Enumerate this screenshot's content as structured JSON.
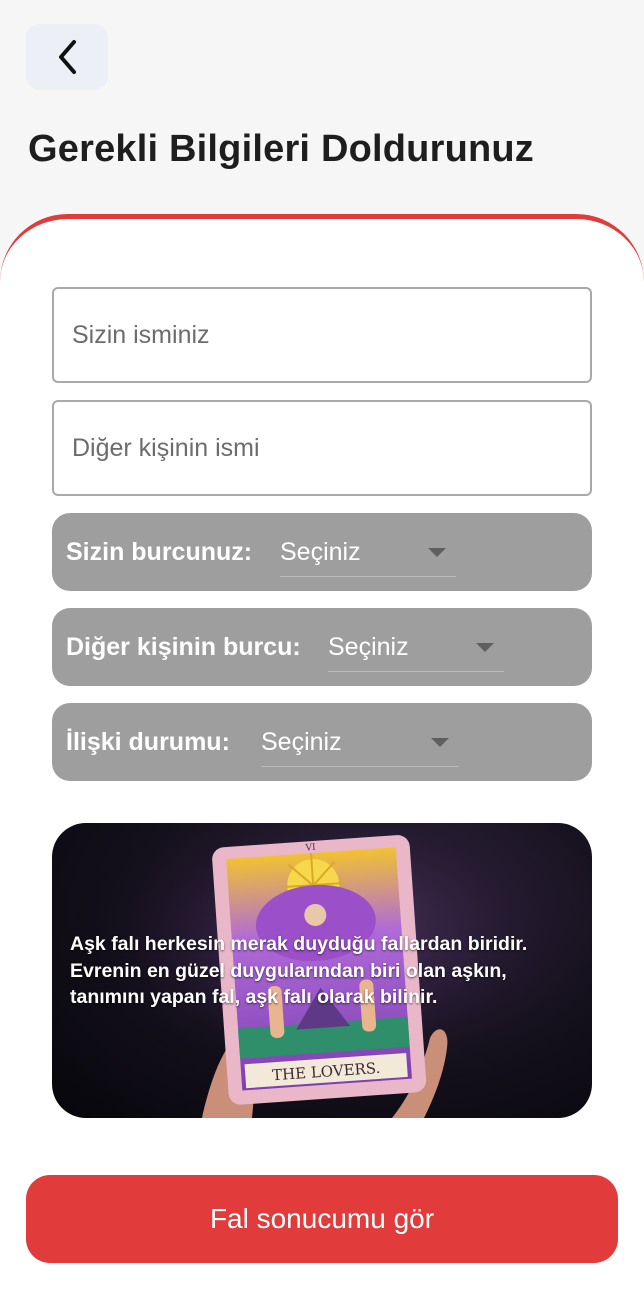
{
  "header": {
    "back_icon": "chevron-left-icon",
    "title": "Gerekli Bilgileri Doldurunuz"
  },
  "form": {
    "name_placeholder": "Sizin isminiz",
    "other_name_placeholder": "Diğer kişinin ismi",
    "zodiac": {
      "label": "Sizin burcunuz:",
      "value": "Seçiniz"
    },
    "other_zodiac": {
      "label": "Diğer kişinin burcu:",
      "value": "Seçiniz"
    },
    "relationship": {
      "label": "İlişki durumu:",
      "value": "Seçiniz"
    }
  },
  "info_card": {
    "text": "Aşk falı herkesin merak duyduğu fallardan biridir. Evrenin en güzel duygularından biri olan aşkın, tanımını yapan fal, aşk falı olarak bilinir.",
    "tarot_numeral": "VI",
    "tarot_name": "THE LOVERS."
  },
  "cta": {
    "label": "Fal sonucumu gör"
  },
  "colors": {
    "accent": "#e23b3b",
    "select_background": "#9e9e9e",
    "page_background": "#f6f6f7"
  }
}
